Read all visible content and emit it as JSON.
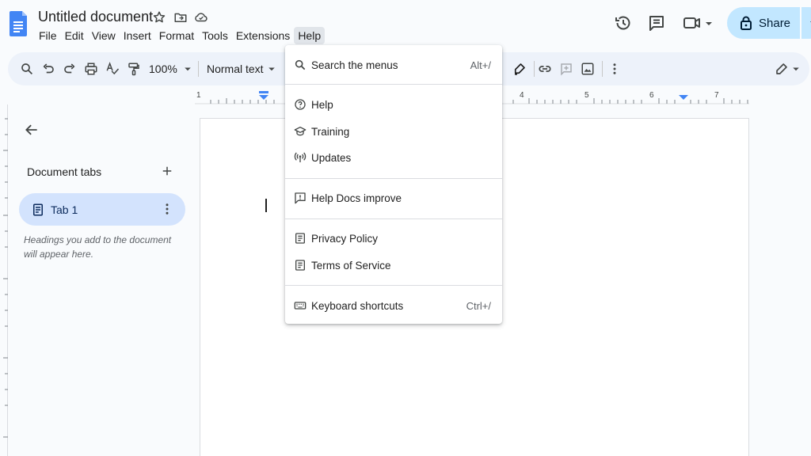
{
  "document": {
    "title": "Untitled document"
  },
  "menu_bar": [
    "File",
    "Edit",
    "View",
    "Insert",
    "Format",
    "Tools",
    "Extensions",
    "Help"
  ],
  "share": {
    "label": "Share"
  },
  "toolbar": {
    "zoom": "100%",
    "style": "Normal text"
  },
  "ruler": {
    "labels": [
      "1",
      "4",
      "5",
      "6",
      "7"
    ]
  },
  "sidebar": {
    "heading": "Document tabs",
    "tab_label": "Tab 1",
    "hint": "Headings you add to the document will appear here."
  },
  "help_menu": {
    "search": {
      "label": "Search the menus",
      "shortcut": "Alt+/",
      "icon": "search-icon"
    },
    "help": {
      "label": "Help",
      "icon": "question-circle-icon"
    },
    "training": {
      "label": "Training",
      "icon": "graduation-cap-icon"
    },
    "updates": {
      "label": "Updates",
      "icon": "broadcast-icon"
    },
    "improve": {
      "label": "Help Docs improve",
      "icon": "feedback-icon"
    },
    "privacy": {
      "label": "Privacy Policy",
      "icon": "document-icon"
    },
    "terms": {
      "label": "Terms of Service",
      "icon": "document-icon"
    },
    "keyboard": {
      "label": "Keyboard shortcuts",
      "shortcut": "Ctrl+/",
      "icon": "keyboard-icon"
    }
  },
  "colors": {
    "accent": "#1a73e8",
    "share_bg": "#c2e7ff",
    "toolbar_bg": "#edf2fa",
    "active_tab_bg": "#d3e3fd"
  }
}
